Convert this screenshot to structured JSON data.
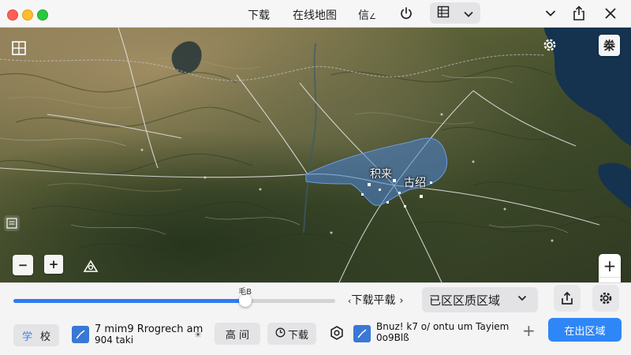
{
  "titlebar": {
    "download_label": "下载",
    "online_map_label": "在线地图",
    "info_label": "信",
    "icons": [
      "power-icon",
      "map-layer-icon",
      "chevron-down-icon",
      "share-icon",
      "close-icon"
    ]
  },
  "map": {
    "labels": {
      "city_1": "积来",
      "city_2": "古绍"
    },
    "layers_button": "桊",
    "controls": {
      "zoom_in": "+",
      "zoom_out": "−"
    },
    "colors": {
      "download_region": "#4a84d6",
      "roads": "#e6e6e6",
      "water": "#1a3a5c"
    }
  },
  "panel": {
    "slider": {
      "value_label": "毛B",
      "fraction": 0.72
    },
    "download_smooth_label": "下载平载",
    "region_select": {
      "selected": "已区区质区域"
    },
    "left_tab": {
      "a": "学",
      "b": "校"
    },
    "task1": {
      "line1": "7 mim9 Rrogrech am",
      "line2": "904 taki"
    },
    "task1_action": "☀",
    "tags": {
      "a": "高 间",
      "b": "下载"
    },
    "task2": {
      "line1": "Bnuz! k7 o/ ontu um Tayiem",
      "line2": "0o9Blß"
    },
    "add_label": "+",
    "primary_button": "在出区域",
    "accent_color": "#2f86f6"
  }
}
